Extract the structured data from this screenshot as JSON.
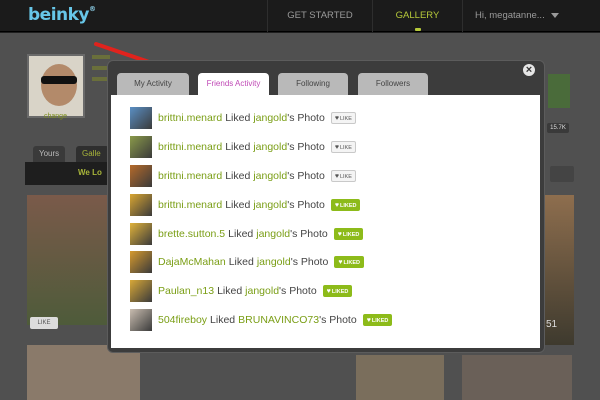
{
  "topnav": {
    "logo": "beinky",
    "logo_mark": "®",
    "get_started": "GET STARTED",
    "gallery": "GALLERY",
    "user": "Hi, megatanne..."
  },
  "background": {
    "change_label": "change",
    "tab_yours": "Yours",
    "tab_gallery": "Galle",
    "strip_label": "We Lo",
    "like_label": "LIKE",
    "count_badge": "15.7K",
    "count_51": "51"
  },
  "modal": {
    "tabs": [
      {
        "label": "My Activity"
      },
      {
        "label": "Friends Activity"
      },
      {
        "label": "Following"
      },
      {
        "label": "Followers"
      }
    ],
    "close": "×",
    "activities": [
      {
        "user": "brittni.menard",
        "verb": "Liked",
        "owner": "jangold",
        "suffix": "'s Photo",
        "status": "LIKE",
        "thumb": "#5a8fc4"
      },
      {
        "user": "brittni.menard",
        "verb": "Liked",
        "owner": "jangold",
        "suffix": "'s Photo",
        "status": "LIKE",
        "thumb": "#8a9a4a"
      },
      {
        "user": "brittni.menard",
        "verb": "Liked",
        "owner": "jangold",
        "suffix": "'s Photo",
        "status": "LIKE",
        "thumb": "#b56a2a"
      },
      {
        "user": "brittni.menard",
        "verb": "Liked",
        "owner": "jangold",
        "suffix": "'s Photo",
        "status": "LIKED",
        "thumb": "#d9a632"
      },
      {
        "user": "brette.sutton.5",
        "verb": "Liked",
        "owner": "jangold",
        "suffix": "'s Photo",
        "status": "LIKED",
        "thumb": "#e0b23a"
      },
      {
        "user": "DajaMcMahan",
        "verb": "Liked",
        "owner": "jangold",
        "suffix": "'s Photo",
        "status": "LIKED",
        "thumb": "#d69a2e"
      },
      {
        "user": "Paulan_n13",
        "verb": "Liked",
        "owner": "jangold",
        "suffix": "'s Photo",
        "status": "LIKED",
        "thumb": "#d8a838"
      },
      {
        "user": "504fireboy",
        "verb": "Liked",
        "owner": "BRUNAVINCO73",
        "suffix": "'s Photo",
        "status": "LIKED",
        "thumb": "#c9bdb0"
      }
    ]
  },
  "colors": {
    "accent_green": "#8dbb1a",
    "link_green": "#7a9e15",
    "active_tab": "#c04ab6"
  },
  "icons": [
    "close-icon",
    "heart-icon",
    "caret-down-icon",
    "arrow-annotation"
  ]
}
